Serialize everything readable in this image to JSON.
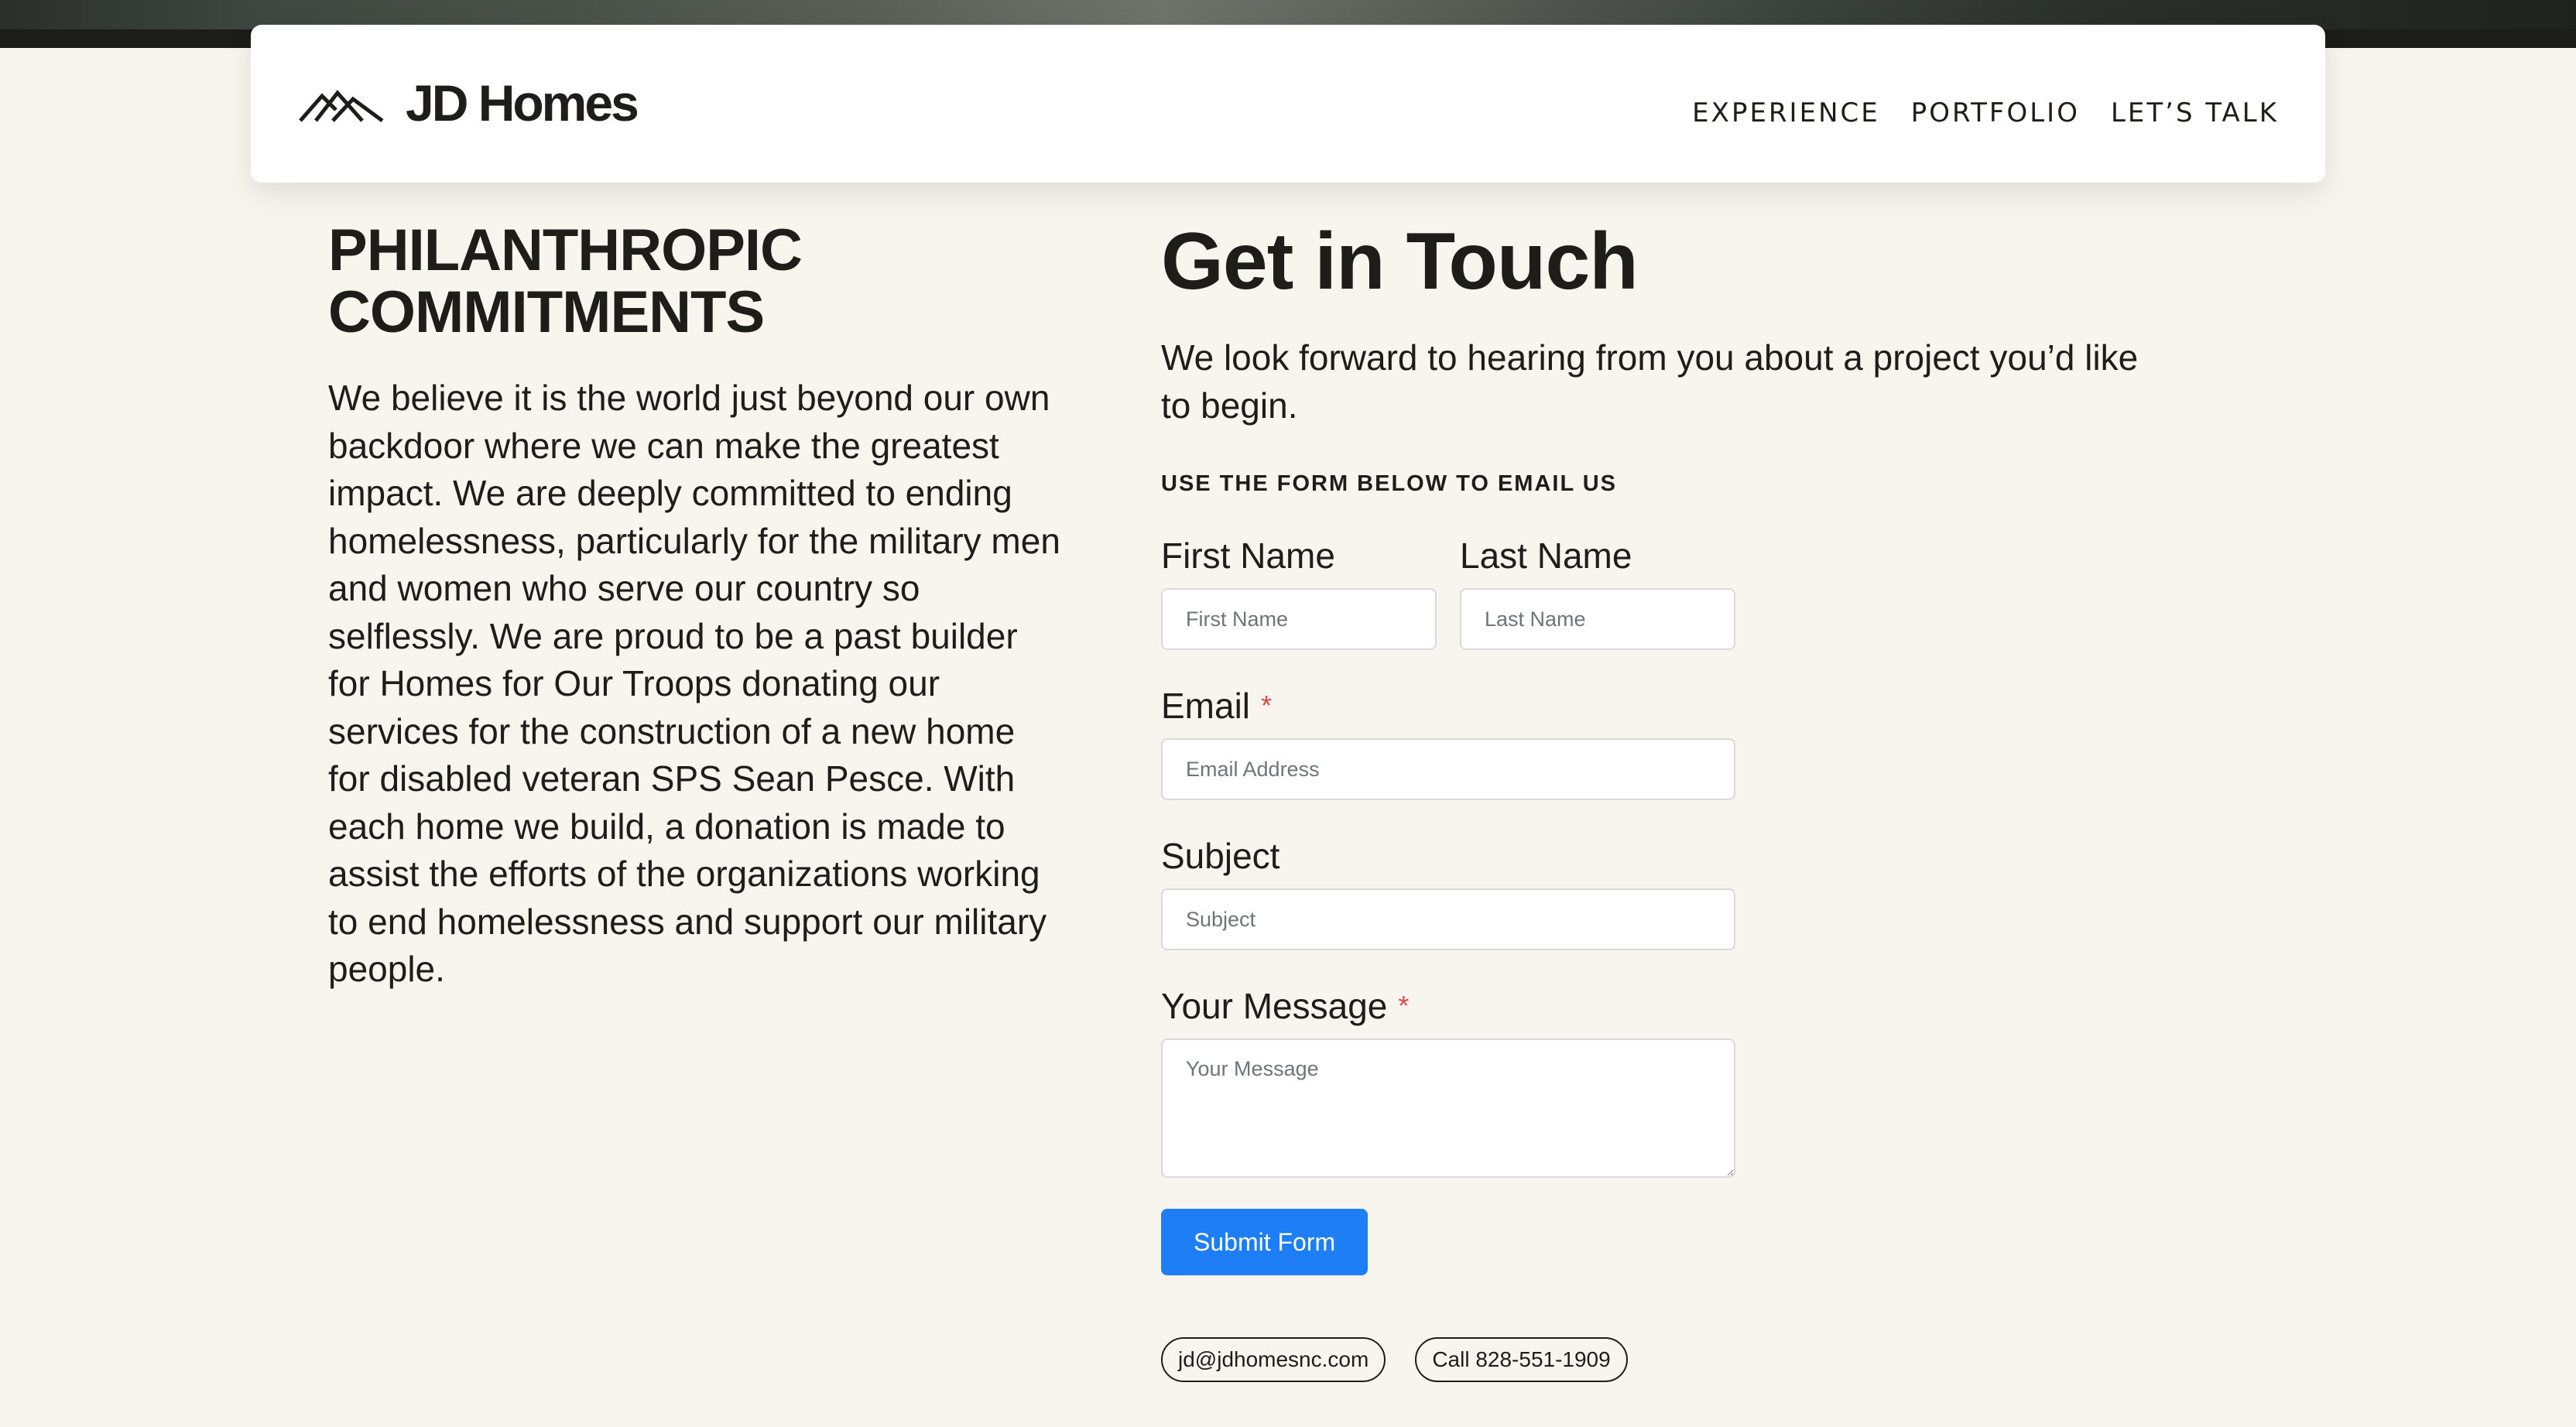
{
  "header": {
    "logo_text": "JD Homes",
    "nav": [
      {
        "label": "EXPERIENCE"
      },
      {
        "label": "PORTFOLIO"
      },
      {
        "label": "LET’S TALK"
      }
    ]
  },
  "philanthropy": {
    "title": "PHILANTHROPIC COMMITMENTS",
    "body": "We believe it is the world just beyond our own backdoor where we can make the greatest impact. We are deeply committed to ending homelessness, particularly for the military men and women who serve our country so selflessly. We are proud to be a past builder for Homes for Our Troops donating our services for the construction of a new home for disabled veteran SPS Sean Pesce. With each home we build, a donation is made to assist the efforts of the organizations working to end homelessness and support our military people."
  },
  "contact": {
    "title": "Get in Touch",
    "intro": "We look forward to hearing from you about a project you’d like to begin.",
    "form_note": "USE THE FORM BELOW TO EMAIL US",
    "fields": {
      "first_name": {
        "label": "First Name",
        "placeholder": "First Name",
        "value": ""
      },
      "last_name": {
        "label": "Last Name",
        "placeholder": "Last Name",
        "value": ""
      },
      "email": {
        "label": "Email",
        "placeholder": "Email Address",
        "value": "",
        "required_mark": "*"
      },
      "subject": {
        "label": "Subject",
        "placeholder": "Subject",
        "value": ""
      },
      "message": {
        "label": "Your Message",
        "placeholder": "Your Message",
        "value": "",
        "required_mark": "*"
      }
    },
    "submit_label": "Submit Form",
    "email_pill": "jd@jdhomesnc.com",
    "phone_pill": "Call 828-551-1909"
  },
  "colors": {
    "background": "#f8f5ef",
    "accent": "#1e7ef5",
    "required": "#e04848",
    "text": "#1f1d1a"
  },
  "icons": {
    "logo_mark": "mountain-roof-icon"
  }
}
